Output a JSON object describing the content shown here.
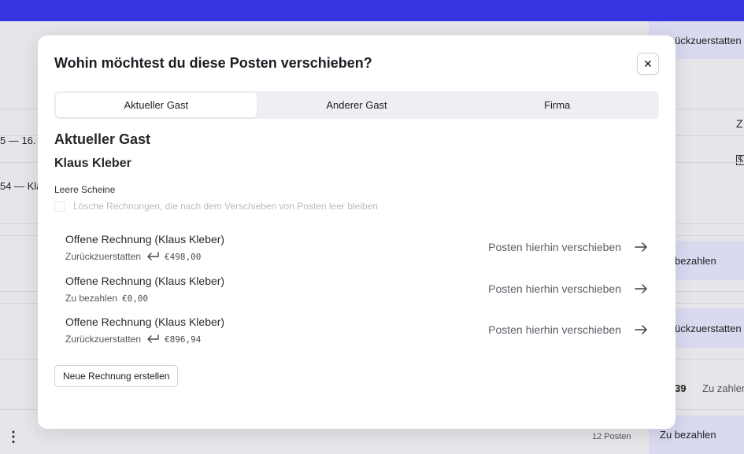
{
  "background": {
    "right_items": [
      "ückzuerstatten",
      "Z",
      "$",
      "bezahlen",
      "ückzuerstatten",
      "Zu bezahlen"
    ],
    "left_items": [
      "5 — 16.",
      "54 — Kla"
    ],
    "row_value": "39",
    "row_status": "Zu zahlen",
    "posts_count": "12 Posten",
    "menu_glyph": "⋮"
  },
  "modal": {
    "title": "Wohin möchtest du diese Posten verschieben?",
    "close_glyph": "✕",
    "tabs": [
      {
        "label": "Aktueller Gast",
        "active": true
      },
      {
        "label": "Anderer Gast",
        "active": false
      },
      {
        "label": "Firma",
        "active": false
      }
    ],
    "section_title": "Aktueller Gast",
    "guest_name": "Klaus Kleber",
    "empty_invoices_label": "Leere Scheine",
    "checkbox_label": "Lösche Rechnungen, die nach dem Verschieben von Posten leer bleiben",
    "invoices": [
      {
        "title": "Offene Rechnung (Klaus Kleber)",
        "status": "Zurückzuerstatten",
        "amount": "€498,00",
        "has_return_icon": true,
        "action": "Posten hierhin verschieben"
      },
      {
        "title": "Offene Rechnung (Klaus Kleber)",
        "status": "Zu bezahlen",
        "amount": "€0,00",
        "has_return_icon": false,
        "action": "Posten hierhin verschieben"
      },
      {
        "title": "Offene Rechnung (Klaus Kleber)",
        "status": "Zurückzuerstatten",
        "amount": "€896,94",
        "has_return_icon": true,
        "action": "Posten hierhin verschieben"
      }
    ],
    "new_invoice_button": "Neue Rechnung erstellen"
  },
  "colors": {
    "topbar": "#3434e0",
    "overlay_background": "#e6e6ea",
    "right_panel": "#d9d9f0"
  }
}
